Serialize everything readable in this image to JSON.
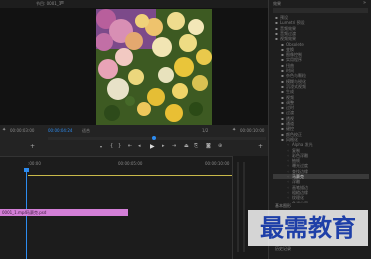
{
  "program": {
    "tab_label": "节目: 0001_1",
    "menu_glyph": "≡",
    "timecode_left": "00:00:04:24",
    "fit_label": "适合",
    "fraction": "1/2",
    "timecode_right": "00:00:10:00"
  },
  "source": {
    "timecode": "00:00:03:00"
  },
  "effects": {
    "tab_label": "效果",
    "close_glyph": "»",
    "search_placeholder": "",
    "root_items": [
      {
        "label": "预设",
        "color": "#7a7a7a"
      },
      {
        "label": "Lumetri 预设",
        "color": "#7a7a7a"
      },
      {
        "label": "音频效果",
        "color": "#7a7a7a"
      },
      {
        "label": "音频过渡",
        "color": "#7a7a7a"
      },
      {
        "label": "视频效果",
        "color": "#7a7a7a"
      }
    ],
    "sub_items": [
      {
        "label": "Obsolete",
        "color": "#7a7a7a"
      },
      {
        "label": "变换",
        "color": "#7a7a7a"
      },
      {
        "label": "图像控制",
        "color": "#7a7a7a"
      },
      {
        "label": "实用程序",
        "color": "#7a7a7a"
      },
      {
        "label": "扭曲",
        "color": "#7a7a7a"
      },
      {
        "label": "时间",
        "color": "#7a7a7a"
      },
      {
        "label": "杂色与颗粒",
        "color": "#7a7a7a"
      },
      {
        "label": "模糊与锐化",
        "color": "#7a7a7a"
      },
      {
        "label": "沉浸式视频",
        "color": "#7a7a7a"
      },
      {
        "label": "生成",
        "color": "#7a7a7a"
      },
      {
        "label": "视频",
        "color": "#7a7a7a"
      },
      {
        "label": "调整",
        "color": "#7a7a7a"
      },
      {
        "label": "过时",
        "color": "#7a7a7a"
      },
      {
        "label": "过渡",
        "color": "#7a7a7a"
      },
      {
        "label": "透视",
        "color": "#7a7a7a"
      },
      {
        "label": "通道",
        "color": "#7a7a7a"
      },
      {
        "label": "键控",
        "color": "#7a7a7a"
      },
      {
        "label": "颜色校正",
        "color": "#7a7a7a"
      },
      {
        "label": "风格化",
        "color": "#7a7a7a"
      },
      {
        "label": "视频过渡",
        "color": "#7a7a7a"
      }
    ],
    "highlight_label": "马赛克",
    "deep_items": [
      {
        "label": "Alpha 发光",
        "color": "#7a7a7a"
      },
      {
        "label": "复制",
        "color": "#7a7a7a"
      },
      {
        "label": "彩色浮雕",
        "color": "#7a7a7a"
      },
      {
        "label": "抽帧",
        "color": "#7a7a7a"
      },
      {
        "label": "曝光过度",
        "color": "#7a7a7a"
      },
      {
        "label": "查找边缘",
        "color": "#7a7a7a"
      },
      {
        "label": "浮雕",
        "color": "#7a7a7a"
      },
      {
        "label": "画笔描边",
        "color": "#7a7a7a"
      },
      {
        "label": "粗糙边缘",
        "color": "#7a7a7a"
      },
      {
        "label": "纹理化",
        "color": "#7a7a7a"
      },
      {
        "label": "色调分离",
        "color": "#7a7a7a"
      },
      {
        "label": "闪光灯",
        "color": "#7a7a7a"
      },
      {
        "label": "阈值",
        "color": "#7a7a7a"
      }
    ],
    "tail_items": [
      {
        "label": "3D 运动",
        "color": "#7a7a7a"
      },
      {
        "label": "内滑",
        "color": "#7a7a7a"
      },
      {
        "label": "划像",
        "color": "#7a7a7a"
      },
      {
        "label": "擦除",
        "color": "#7a7a7a"
      }
    ],
    "bottom_labels": [
      "基本图形",
      "基本声音"
    ],
    "footer_label": "历史记录"
  },
  "timeline": {
    "ruler_left": ":00:00",
    "ruler_mid": "00:00:05:00",
    "ruler_right": "00:00:10:00",
    "clip_v1_left": "0001_1.mp4",
    "clip_v1_right": "马赛克.psd"
  },
  "watermark": "最需教育"
}
